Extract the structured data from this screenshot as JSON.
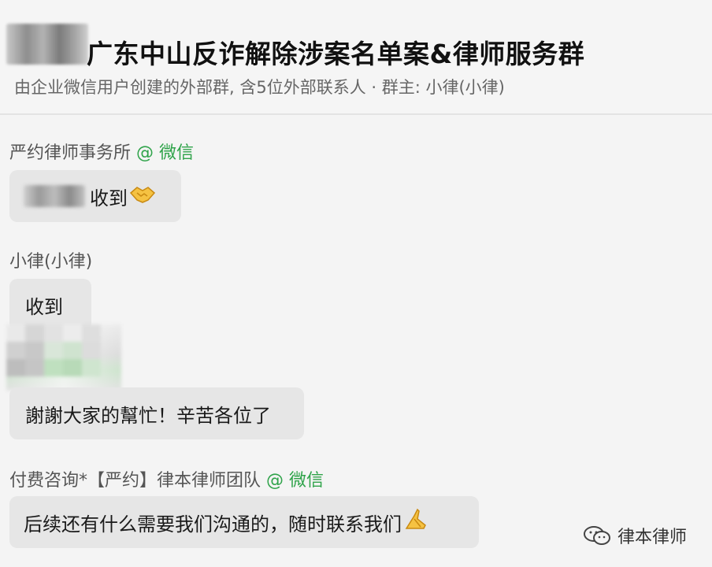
{
  "header": {
    "title": "广东中山反诈解除涉案名单案&律师服务群",
    "subtitle": "由企业微信用户创建的外部群, 含5位外部联系人 · 群主: 小律(小律)"
  },
  "messages": [
    {
      "sender_name": "严约律师事务所",
      "sender_suffix": "@ 微信",
      "text": "收到",
      "emoji_icon": "handshake-emoji"
    },
    {
      "sender_name": "小律(小律)",
      "text": "收到"
    },
    {
      "text": "謝謝大家的幫忙！辛苦各位了"
    },
    {
      "sender_name": "付费咨询*【严约】律本律师团队",
      "sender_suffix": "@ 微信",
      "text": "后续还有什么需要我们沟通的，随时联系我们",
      "emoji_icon": "folded-hands-emoji"
    }
  ],
  "watermark": {
    "icon": "wechat-official-account-icon",
    "label": "律本律师"
  },
  "colors": {
    "background": "#f4f4f4",
    "bubble": "#e6e6e6",
    "wechat_green": "#2fa34a"
  }
}
